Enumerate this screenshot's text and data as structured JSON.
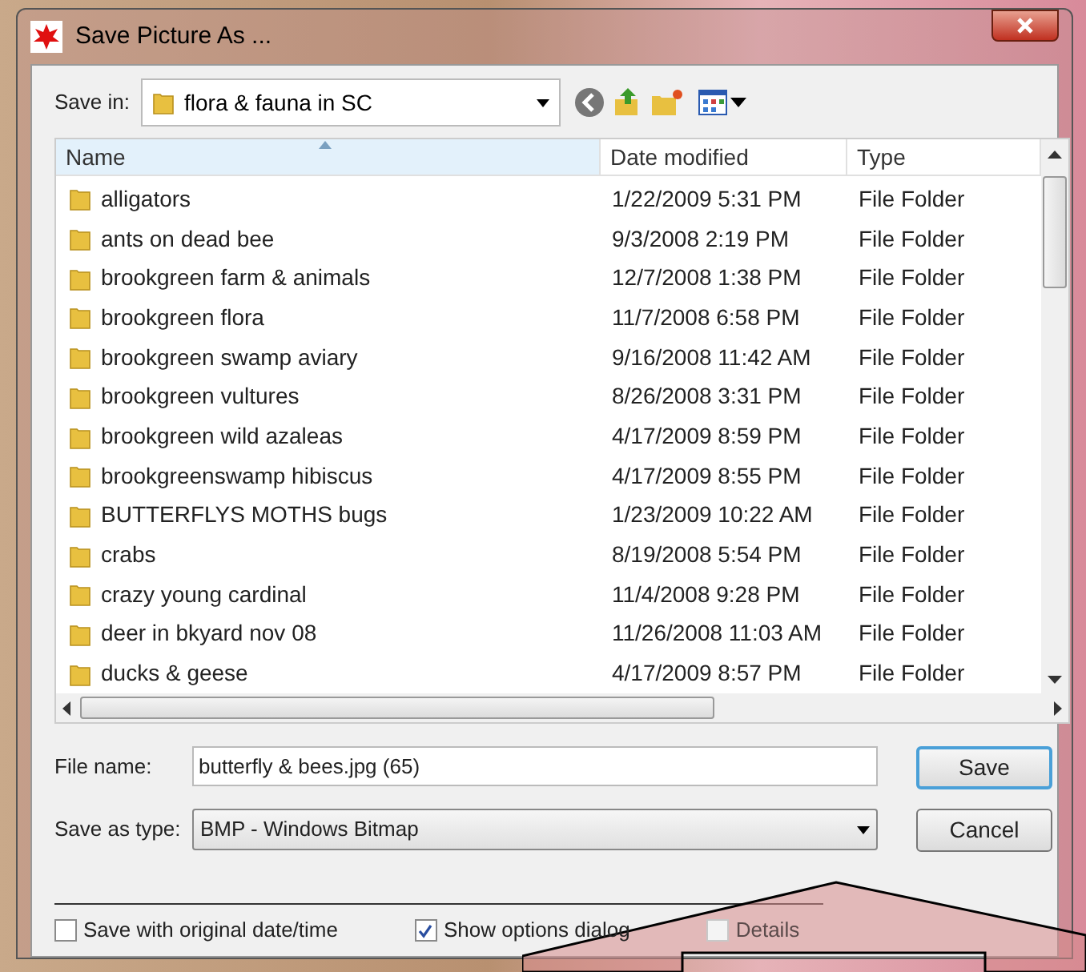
{
  "window": {
    "title": "Save Picture As ..."
  },
  "save_in": {
    "label": "Save in:",
    "value": "flora & fauna in SC"
  },
  "columns": [
    {
      "label": "Name",
      "selected": true
    },
    {
      "label": "Date modified",
      "selected": false
    },
    {
      "label": "Type",
      "selected": false
    }
  ],
  "rows": [
    {
      "name": "alligators",
      "date": "1/22/2009 5:31 PM",
      "type": "File Folder"
    },
    {
      "name": "ants on dead bee",
      "date": "9/3/2008 2:19 PM",
      "type": "File Folder"
    },
    {
      "name": "brookgreen farm & animals",
      "date": "12/7/2008 1:38 PM",
      "type": "File Folder"
    },
    {
      "name": "brookgreen flora",
      "date": "11/7/2008 6:58 PM",
      "type": "File Folder"
    },
    {
      "name": "brookgreen swamp aviary",
      "date": "9/16/2008 11:42 AM",
      "type": "File Folder"
    },
    {
      "name": "brookgreen vultures",
      "date": "8/26/2008 3:31 PM",
      "type": "File Folder"
    },
    {
      "name": "brookgreen wild azaleas",
      "date": "4/17/2009 8:59 PM",
      "type": "File Folder"
    },
    {
      "name": "brookgreenswamp hibiscus",
      "date": "4/17/2009 8:55 PM",
      "type": "File Folder"
    },
    {
      "name": "BUTTERFLYS MOTHS bugs",
      "date": "1/23/2009 10:22 AM",
      "type": "File Folder"
    },
    {
      "name": "crabs",
      "date": "8/19/2008 5:54 PM",
      "type": "File Folder"
    },
    {
      "name": "crazy young cardinal",
      "date": "11/4/2008 9:28 PM",
      "type": "File Folder"
    },
    {
      "name": "deer in bkyard nov 08",
      "date": "11/26/2008 11:03 AM",
      "type": "File Folder"
    },
    {
      "name": "ducks & geese",
      "date": "4/17/2009 8:57 PM",
      "type": "File Folder"
    }
  ],
  "file_name": {
    "label": "File name:",
    "value": "butterfly & bees.jpg (65)"
  },
  "save_as_type": {
    "label": "Save as type:",
    "value": "BMP - Windows Bitmap"
  },
  "buttons": [
    {
      "label": "Save",
      "default": true
    },
    {
      "label": "Cancel",
      "default": false
    }
  ],
  "options": [
    {
      "label": "Save with original date/time",
      "checked": false,
      "disabled": false
    },
    {
      "label": "Show options dialog",
      "checked": true,
      "disabled": false
    },
    {
      "label": "Details",
      "checked": false,
      "disabled": true
    }
  ]
}
